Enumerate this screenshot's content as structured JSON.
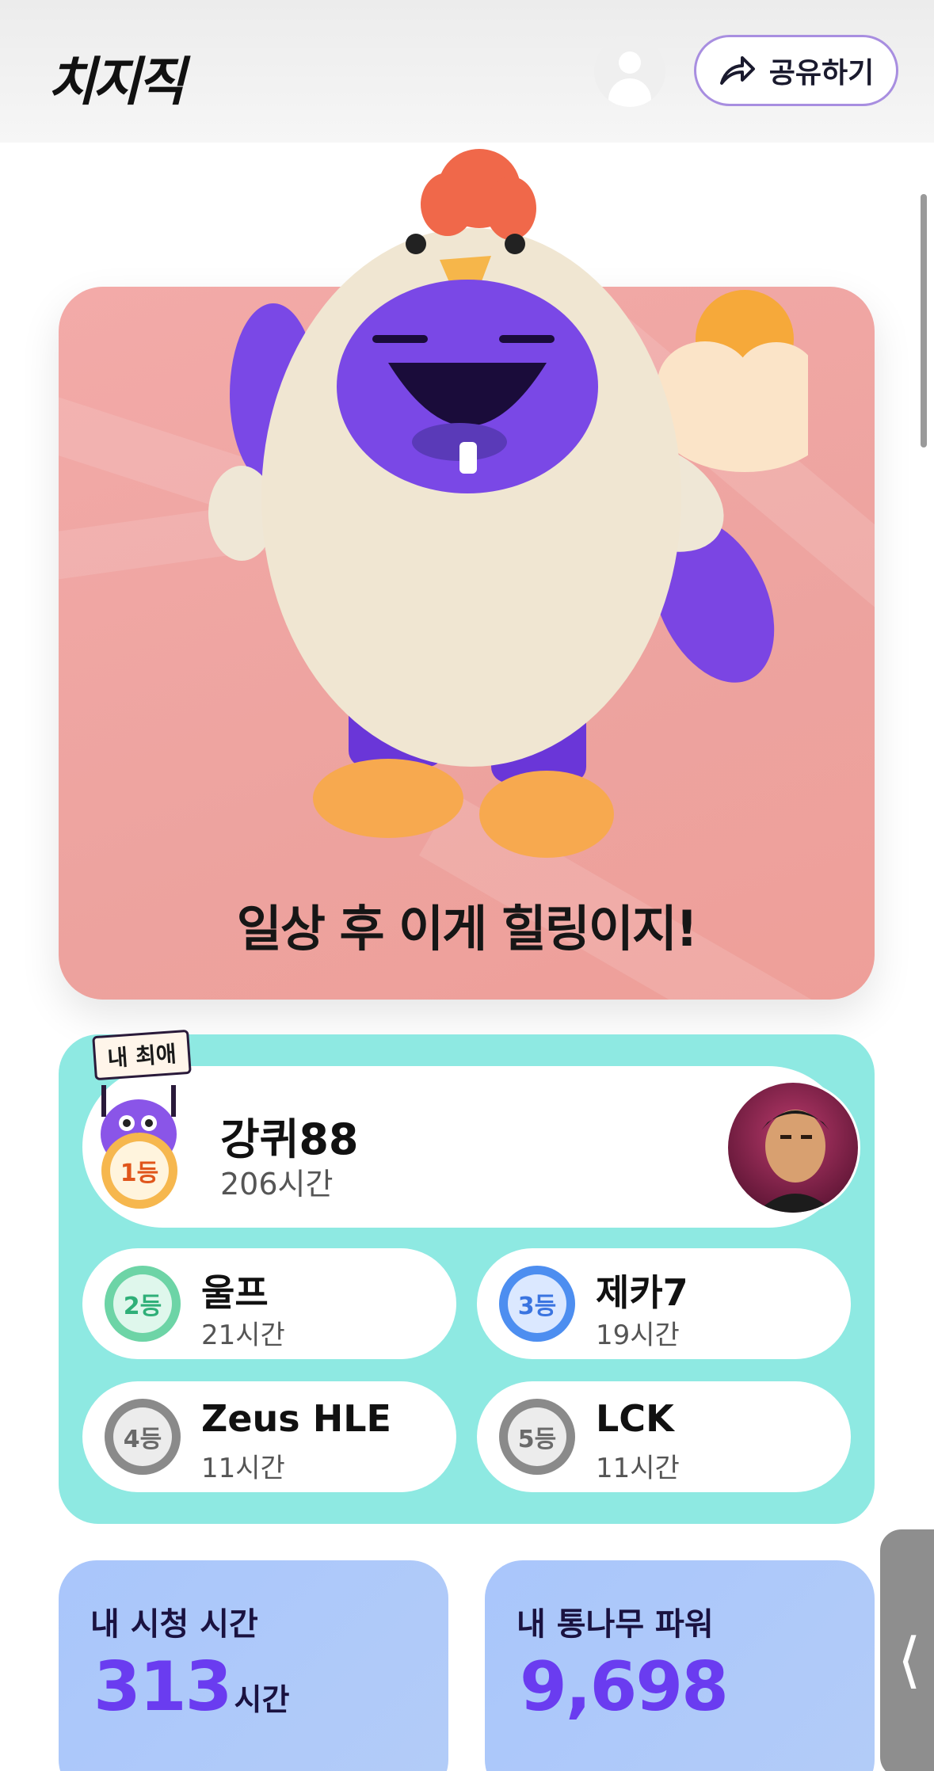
{
  "header": {
    "logo": "치지직",
    "share_label": "공유하기",
    "icons": {
      "avatar": "user-avatar-icon",
      "share": "share-arrow-icon"
    }
  },
  "hero": {
    "caption": "일상 후 이게 힐링이지!",
    "image": "chicken-costume-mascot"
  },
  "ranking": {
    "first": {
      "sign": "내 최애",
      "rank": "1등",
      "name": "강퀴88",
      "hours": "206시간"
    },
    "others": [
      {
        "rank": "2등",
        "name": "울프",
        "hours": "21시간"
      },
      {
        "rank": "3등",
        "name": "제카7",
        "hours": "19시간"
      },
      {
        "rank": "4등",
        "name": "Zeus HLE",
        "hours": "11시간"
      },
      {
        "rank": "5등",
        "name": "LCK",
        "hours": "11시간"
      }
    ]
  },
  "stats": {
    "watch_time": {
      "title": "내 시청 시간",
      "value": "313",
      "unit": "시간"
    },
    "power": {
      "title": "내 통나무 파워",
      "value": "9,698"
    }
  },
  "colors": {
    "accent_purple": "#6a3cf0",
    "ranking_bg": "#8ee9e2",
    "hero_bg": "#f3aaa8",
    "stat_bg": "#a9c6fb"
  }
}
